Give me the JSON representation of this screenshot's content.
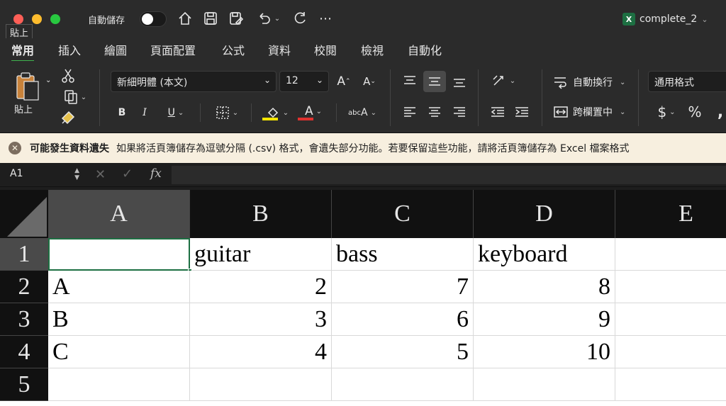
{
  "titlebar": {
    "autosave_label": "自動儲存",
    "tooltip": "貼上",
    "doc_title": "complete_2",
    "doc_badge": "X"
  },
  "tabs": [
    "常用",
    "插入",
    "繪圖",
    "頁面配置",
    "公式",
    "資料",
    "校閱",
    "檢視",
    "自動化"
  ],
  "active_tab": "常用",
  "ribbon": {
    "paste_label": "貼上",
    "font_name": "新細明體 (本文)",
    "font_size": "12",
    "grow_font": "A",
    "shrink_font": "A",
    "bold": "B",
    "italic": "I",
    "underline": "U",
    "font_color_letter": "A",
    "vertical_text_label": "abc",
    "wrap_text_label": "自動換行",
    "merge_center_label": "跨欄置中",
    "number_format": "通用格式",
    "currency_symbol": "$",
    "percent_symbol": "%",
    "highlight_color": "#f5e500",
    "font_color": "#e0322f"
  },
  "warning": {
    "title": "可能發生資料遺失",
    "message": "如果將活頁簿儲存為逗號分隔 (.csv) 格式，會遺失部分功能。若要保留這些功能，請將活頁簿儲存為 Excel 檔案格式"
  },
  "formula_bar": {
    "cell_ref": "A1",
    "cancel": "✕",
    "enter": "✓",
    "fx": "fx",
    "value": ""
  },
  "sheet": {
    "columns": [
      "A",
      "B",
      "C",
      "D",
      "E"
    ],
    "rows": [
      "1",
      "2",
      "3",
      "4",
      "5"
    ],
    "active_cell": "A1",
    "cells": [
      [
        "",
        "guitar",
        "bass",
        "keyboard",
        ""
      ],
      [
        "A",
        "2",
        "7",
        "8",
        ""
      ],
      [
        "B",
        "3",
        "6",
        "9",
        ""
      ],
      [
        "C",
        "4",
        "5",
        "10",
        ""
      ],
      [
        "",
        "",
        "",
        "",
        ""
      ]
    ]
  }
}
